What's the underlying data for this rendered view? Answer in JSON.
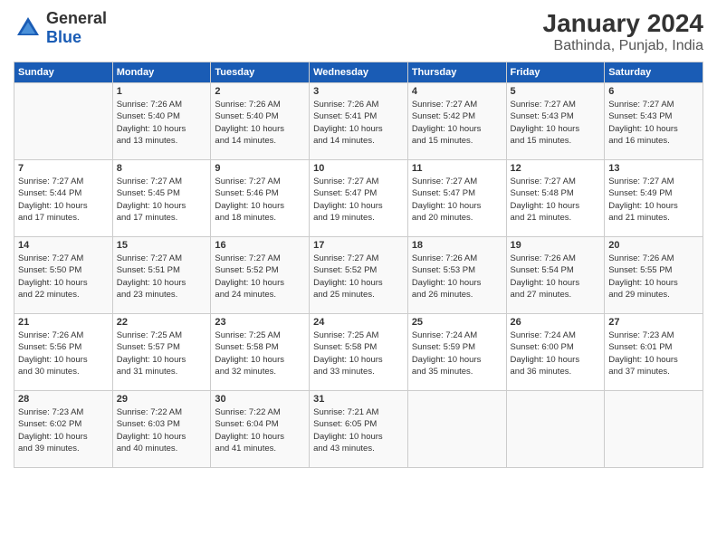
{
  "header": {
    "logo_general": "General",
    "logo_blue": "Blue",
    "title": "January 2024",
    "subtitle": "Bathinda, Punjab, India"
  },
  "columns": [
    "Sunday",
    "Monday",
    "Tuesday",
    "Wednesday",
    "Thursday",
    "Friday",
    "Saturday"
  ],
  "weeks": [
    [
      {
        "day": "",
        "info": ""
      },
      {
        "day": "1",
        "info": "Sunrise: 7:26 AM\nSunset: 5:40 PM\nDaylight: 10 hours\nand 13 minutes."
      },
      {
        "day": "2",
        "info": "Sunrise: 7:26 AM\nSunset: 5:40 PM\nDaylight: 10 hours\nand 14 minutes."
      },
      {
        "day": "3",
        "info": "Sunrise: 7:26 AM\nSunset: 5:41 PM\nDaylight: 10 hours\nand 14 minutes."
      },
      {
        "day": "4",
        "info": "Sunrise: 7:27 AM\nSunset: 5:42 PM\nDaylight: 10 hours\nand 15 minutes."
      },
      {
        "day": "5",
        "info": "Sunrise: 7:27 AM\nSunset: 5:43 PM\nDaylight: 10 hours\nand 15 minutes."
      },
      {
        "day": "6",
        "info": "Sunrise: 7:27 AM\nSunset: 5:43 PM\nDaylight: 10 hours\nand 16 minutes."
      }
    ],
    [
      {
        "day": "7",
        "info": "Sunrise: 7:27 AM\nSunset: 5:44 PM\nDaylight: 10 hours\nand 17 minutes."
      },
      {
        "day": "8",
        "info": "Sunrise: 7:27 AM\nSunset: 5:45 PM\nDaylight: 10 hours\nand 17 minutes."
      },
      {
        "day": "9",
        "info": "Sunrise: 7:27 AM\nSunset: 5:46 PM\nDaylight: 10 hours\nand 18 minutes."
      },
      {
        "day": "10",
        "info": "Sunrise: 7:27 AM\nSunset: 5:47 PM\nDaylight: 10 hours\nand 19 minutes."
      },
      {
        "day": "11",
        "info": "Sunrise: 7:27 AM\nSunset: 5:47 PM\nDaylight: 10 hours\nand 20 minutes."
      },
      {
        "day": "12",
        "info": "Sunrise: 7:27 AM\nSunset: 5:48 PM\nDaylight: 10 hours\nand 21 minutes."
      },
      {
        "day": "13",
        "info": "Sunrise: 7:27 AM\nSunset: 5:49 PM\nDaylight: 10 hours\nand 21 minutes."
      }
    ],
    [
      {
        "day": "14",
        "info": "Sunrise: 7:27 AM\nSunset: 5:50 PM\nDaylight: 10 hours\nand 22 minutes."
      },
      {
        "day": "15",
        "info": "Sunrise: 7:27 AM\nSunset: 5:51 PM\nDaylight: 10 hours\nand 23 minutes."
      },
      {
        "day": "16",
        "info": "Sunrise: 7:27 AM\nSunset: 5:52 PM\nDaylight: 10 hours\nand 24 minutes."
      },
      {
        "day": "17",
        "info": "Sunrise: 7:27 AM\nSunset: 5:52 PM\nDaylight: 10 hours\nand 25 minutes."
      },
      {
        "day": "18",
        "info": "Sunrise: 7:26 AM\nSunset: 5:53 PM\nDaylight: 10 hours\nand 26 minutes."
      },
      {
        "day": "19",
        "info": "Sunrise: 7:26 AM\nSunset: 5:54 PM\nDaylight: 10 hours\nand 27 minutes."
      },
      {
        "day": "20",
        "info": "Sunrise: 7:26 AM\nSunset: 5:55 PM\nDaylight: 10 hours\nand 29 minutes."
      }
    ],
    [
      {
        "day": "21",
        "info": "Sunrise: 7:26 AM\nSunset: 5:56 PM\nDaylight: 10 hours\nand 30 minutes."
      },
      {
        "day": "22",
        "info": "Sunrise: 7:25 AM\nSunset: 5:57 PM\nDaylight: 10 hours\nand 31 minutes."
      },
      {
        "day": "23",
        "info": "Sunrise: 7:25 AM\nSunset: 5:58 PM\nDaylight: 10 hours\nand 32 minutes."
      },
      {
        "day": "24",
        "info": "Sunrise: 7:25 AM\nSunset: 5:58 PM\nDaylight: 10 hours\nand 33 minutes."
      },
      {
        "day": "25",
        "info": "Sunrise: 7:24 AM\nSunset: 5:59 PM\nDaylight: 10 hours\nand 35 minutes."
      },
      {
        "day": "26",
        "info": "Sunrise: 7:24 AM\nSunset: 6:00 PM\nDaylight: 10 hours\nand 36 minutes."
      },
      {
        "day": "27",
        "info": "Sunrise: 7:23 AM\nSunset: 6:01 PM\nDaylight: 10 hours\nand 37 minutes."
      }
    ],
    [
      {
        "day": "28",
        "info": "Sunrise: 7:23 AM\nSunset: 6:02 PM\nDaylight: 10 hours\nand 39 minutes."
      },
      {
        "day": "29",
        "info": "Sunrise: 7:22 AM\nSunset: 6:03 PM\nDaylight: 10 hours\nand 40 minutes."
      },
      {
        "day": "30",
        "info": "Sunrise: 7:22 AM\nSunset: 6:04 PM\nDaylight: 10 hours\nand 41 minutes."
      },
      {
        "day": "31",
        "info": "Sunrise: 7:21 AM\nSunset: 6:05 PM\nDaylight: 10 hours\nand 43 minutes."
      },
      {
        "day": "",
        "info": ""
      },
      {
        "day": "",
        "info": ""
      },
      {
        "day": "",
        "info": ""
      }
    ]
  ]
}
